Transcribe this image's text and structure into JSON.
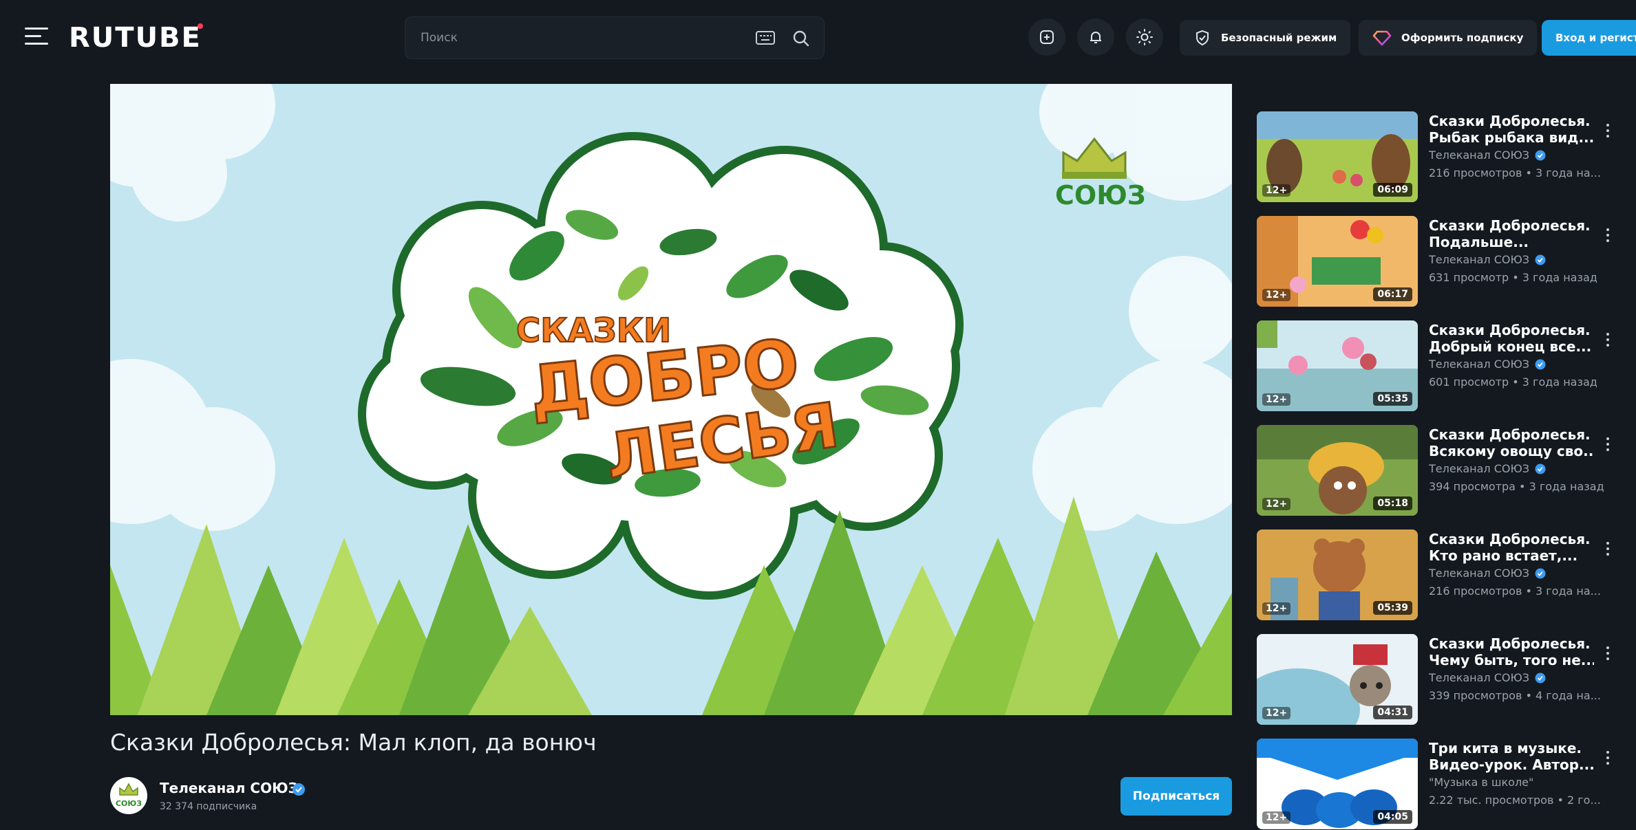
{
  "header": {
    "logo": "RUTUBE",
    "search_placeholder": "Поиск",
    "safe_mode": "Безопасный режим",
    "subscribe_plan": "Оформить подписку",
    "login": "Вход и регистр"
  },
  "player": {
    "cartoon_title_line1": "СКАЗКИ",
    "cartoon_title_line2": "ДОБРО",
    "cartoon_title_line3": "ЛЕСЬЯ",
    "channel_watermark": "СОЮЗ"
  },
  "video": {
    "title": "Сказки Добролесья: Мал клоп, да вонюч",
    "channel_name": "Телеканал СОЮЗ",
    "subscribers": "32 374 подписчика",
    "avatar_text": "СОЮЗ",
    "subscribe_label": "Подписаться"
  },
  "recommendations": [
    {
      "title1": "Сказки Добролесья.",
      "title2": "Рыбак рыбака вид...",
      "channel": "Телеканал СОЮЗ",
      "meta": "216 просмотров • 3 года на...",
      "age": "12+",
      "duration": "06:09",
      "verified": true
    },
    {
      "title1": "Сказки Добролесья.",
      "title2": "Подальше...",
      "channel": "Телеканал СОЮЗ",
      "meta": "631 просмотр • 3 года назад",
      "age": "12+",
      "duration": "06:17",
      "verified": true
    },
    {
      "title1": "Сказки Добролесья.",
      "title2": "Добрый конец все...",
      "channel": "Телеканал СОЮЗ",
      "meta": "601 просмотр • 3 года назад",
      "age": "12+",
      "duration": "05:35",
      "verified": true
    },
    {
      "title1": "Сказки Добролесья.",
      "title2": "Всякому овощу сво...",
      "channel": "Телеканал СОЮЗ",
      "meta": "394 просмотра • 3 года назад",
      "age": "12+",
      "duration": "05:18",
      "verified": true
    },
    {
      "title1": "Сказки Добролесья.",
      "title2": "Кто рано встает,...",
      "channel": "Телеканал СОЮЗ",
      "meta": "216 просмотров • 3 года на...",
      "age": "12+",
      "duration": "05:39",
      "verified": true
    },
    {
      "title1": "Сказки Добролесья.",
      "title2": "Чему быть, того не...",
      "channel": "Телеканал СОЮЗ",
      "meta": "339 просмотров • 4 года на...",
      "age": "12+",
      "duration": "04:31",
      "verified": true
    },
    {
      "title1": "Три кита в музыке.",
      "title2": "Видео-урок. Автор...",
      "channel": "\"Музыка в школе\"",
      "meta": "2.22 тыс. просмотров • 2 го...",
      "age": "12+",
      "duration": "04:05",
      "verified": false
    }
  ],
  "colors": {
    "background": "#14191f",
    "accent": "#1a9be0",
    "verified": "#3d9bf0"
  }
}
